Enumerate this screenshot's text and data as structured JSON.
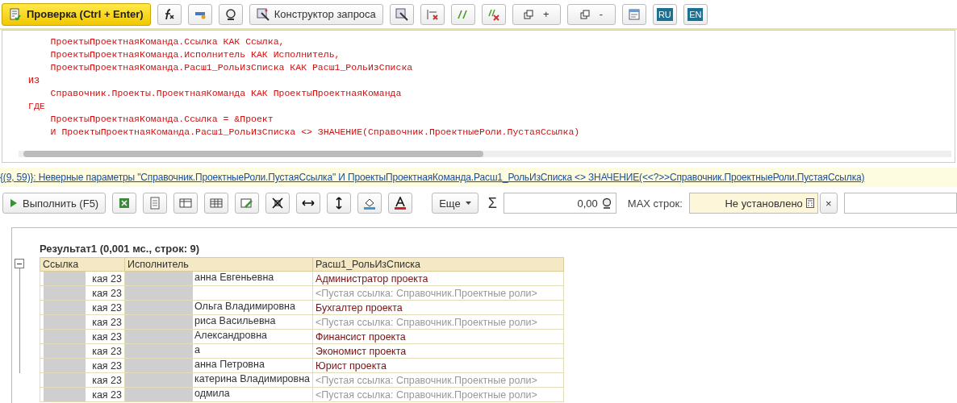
{
  "toolbar": {
    "check_button": "Проверка (Ctrl + Enter)",
    "designer_button": "Конструктор запроса",
    "expand_plus": "+",
    "collapse_minus": "-",
    "lang_buttons": [
      "RU",
      "EN"
    ]
  },
  "editor": {
    "code_lines": [
      "    ПроектыПроектнаяКоманда.Ссылка КАК Ссылка,",
      "    ПроектыПроектнаяКоманда.Исполнитель КАК Исполнитель,",
      "    ПроектыПроектнаяКоманда.Расш1_РольИзСписка КАК Расш1_РольИзСписка",
      "ИЗ",
      "    Справочник.Проекты.ПроектнаяКоманда КАК ПроектыПроектнаяКоманда",
      "ГДЕ",
      "    ПроектыПроектнаяКоманда.Ссылка = &Проект",
      "    И ПроектыПроектнаяКоманда.Расш1_РольИзСписка <> ЗНАЧЕНИЕ(Справочник.ПроектныеРоли.ПустаяСсылка)"
    ]
  },
  "error_message": "{(9, 59)}: Неверные параметры \"Справочник.ПроектныеРоли.ПустаяСсылка\" И ПроектыПроектнаяКоманда.Расш1_РольИзСписка <> ЗНАЧЕНИЕ(<<?>>Справочник.ПроектныеРоли.ПустаяСсылка)",
  "results_toolbar": {
    "run_button": "Выполнить (F5)",
    "more_button": "Еще",
    "sum_symbol": "Σ",
    "sum_value": "0,00",
    "max_rows_label": "MAX строк:",
    "max_rows_value": "Не установлено",
    "clear_symbol": "×"
  },
  "result": {
    "title": "Результат1 (0,001 мс., строк: 9)",
    "expanded": true,
    "columns": [
      "Ссылка",
      "Исполнитель",
      "Расш1_РольИзСписка"
    ],
    "rows": [
      {
        "link": "кая 23",
        "performer": "анна Евгеньевна",
        "role": "Администратор проекта",
        "kind": "value"
      },
      {
        "link": "кая 23",
        "performer": "",
        "role": "<Пустая ссылка: Справочник.Проектные роли>",
        "kind": "empty"
      },
      {
        "link": "кая 23",
        "performer": "Ольга Владимировна",
        "role": "Бухгалтер проекта",
        "kind": "value"
      },
      {
        "link": "кая 23",
        "performer": "риса Васильевна",
        "role": "<Пустая ссылка: Справочник.Проектные роли>",
        "kind": "empty"
      },
      {
        "link": "кая 23",
        "performer": "Александровна",
        "role": "Финансист проекта",
        "kind": "value"
      },
      {
        "link": "кая 23",
        "performer": "а",
        "role": "Экономист проекта",
        "kind": "value"
      },
      {
        "link": "кая 23",
        "performer": "анна Петровна",
        "role": "Юрист проекта",
        "kind": "value"
      },
      {
        "link": "кая 23",
        "performer": "катерина Владимировна",
        "role": "<Пустая ссылка: Справочник.Проектные роли>",
        "kind": "empty"
      },
      {
        "link": "кая 23",
        "performer": "одмила",
        "role": "<Пустая ссылка: Справочник.Проектные роли>",
        "kind": "empty"
      }
    ]
  }
}
